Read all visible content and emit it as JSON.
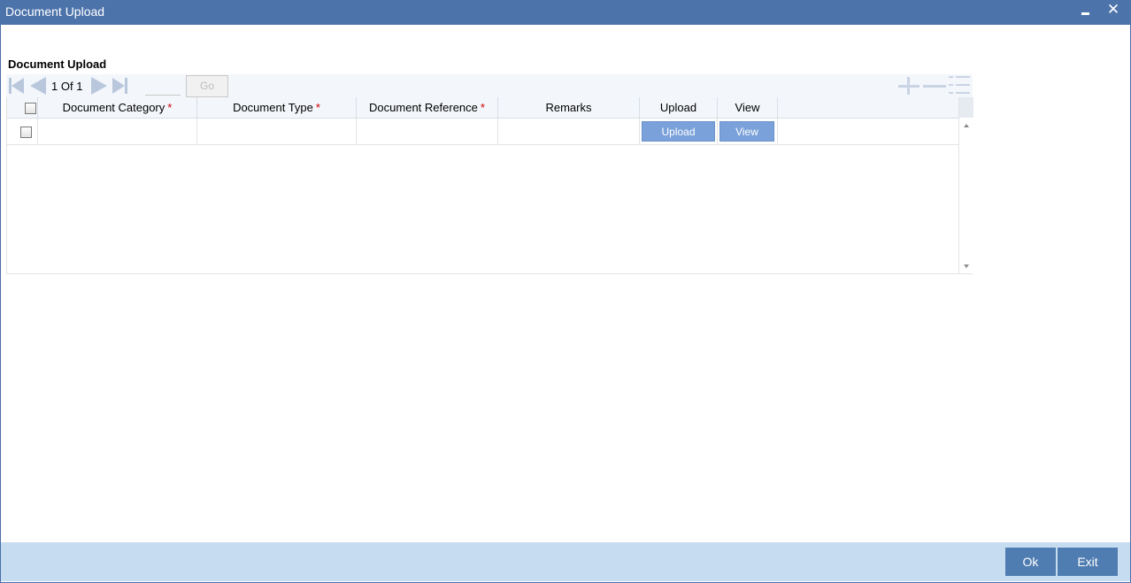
{
  "window": {
    "title": "Document Upload",
    "close_glyph": "✕"
  },
  "section": {
    "title": "Document Upload"
  },
  "pagination": {
    "current_page": "1",
    "of_label": "Of",
    "total_pages": "1",
    "go_label": "Go",
    "page_input_value": ""
  },
  "grid": {
    "columns": [
      {
        "label": "Document Category",
        "required": true
      },
      {
        "label": "Document Type",
        "required": true
      },
      {
        "label": "Document Reference",
        "required": true
      },
      {
        "label": "Remarks",
        "required": false
      },
      {
        "label": "Upload",
        "required": false
      },
      {
        "label": "View",
        "required": false
      }
    ],
    "required_marker": "*",
    "rows": [
      {
        "document_category": "",
        "document_type": "",
        "document_reference": "",
        "remarks": "",
        "upload_button": "Upload",
        "view_button": "View"
      }
    ]
  },
  "footer": {
    "ok_label": "Ok",
    "exit_label": "Exit"
  },
  "icons": {
    "first_page": "first-page-icon",
    "prev_page": "previous-page-icon",
    "next_page": "next-page-icon",
    "last_page": "last-page-icon",
    "add_row": "add-row-icon",
    "delete_row": "delete-row-icon",
    "single_view": "list-view-icon"
  },
  "colors": {
    "titlebar": "#4d73ab",
    "footer": "#c6dcf0",
    "button": "#4f7db1",
    "grid_button": "#7aa1d9",
    "required": "#d20000"
  }
}
